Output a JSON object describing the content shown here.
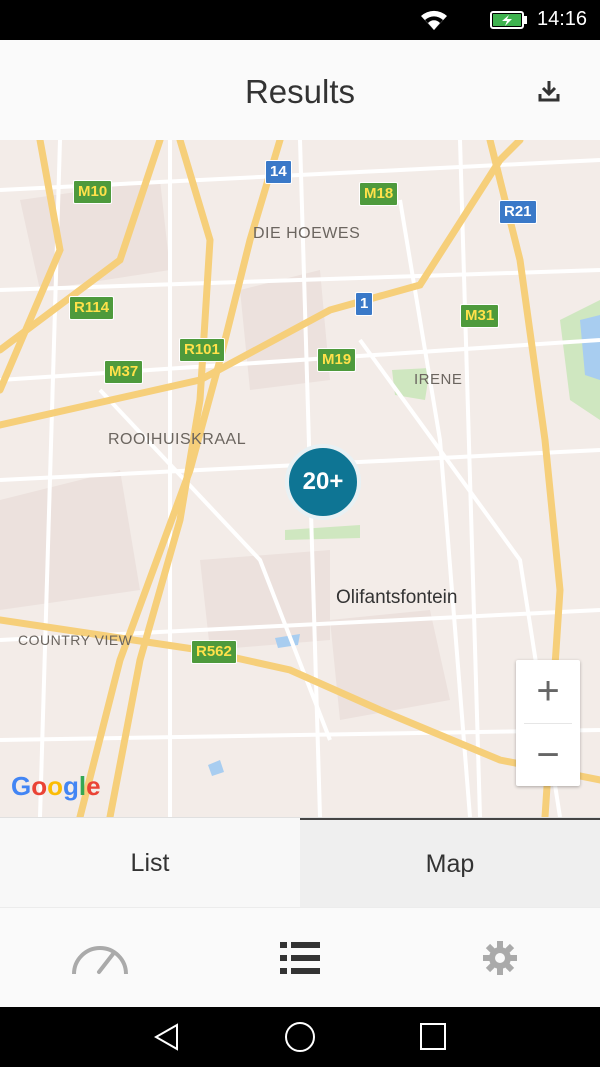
{
  "status_bar": {
    "time": "14:16"
  },
  "app_bar": {
    "title": "Results"
  },
  "map": {
    "places": {
      "die_hoewes": "DIE HOEWES",
      "irene": "IRENE",
      "rooihuiskraal": "ROOIHUISKRAAL",
      "olifantsfontein": "Olifantsfontein",
      "country_view": "COUNTRY VIEW"
    },
    "route_shields": {
      "m10": "M10",
      "m18": "M18",
      "r21": "R21",
      "r114": "R114",
      "r101": "R101",
      "m37": "M37",
      "m19": "M19",
      "m31": "M31",
      "r562": "R562",
      "n14": "14",
      "n1": "1"
    },
    "cluster_label": "20+",
    "zoom_in": "+",
    "zoom_out": "−",
    "attribution": [
      "G",
      "o",
      "o",
      "g",
      "l",
      "e"
    ],
    "colors": {
      "background": "#f3ece8",
      "major_road": "#f6cf7a",
      "minor_road": "#ffffff",
      "water": "#a8cdf0",
      "park": "#cfe7c0",
      "cluster": "#0e7594"
    }
  },
  "tabs": {
    "list": "List",
    "map": "Map",
    "selected": "Map"
  },
  "bottom_nav": {
    "items": [
      "dashboard-gauge-icon",
      "list-icon",
      "settings-gear-icon"
    ],
    "selected": "list-icon"
  },
  "system_nav": {
    "items": [
      "back-icon",
      "home-icon",
      "recents-icon"
    ]
  }
}
